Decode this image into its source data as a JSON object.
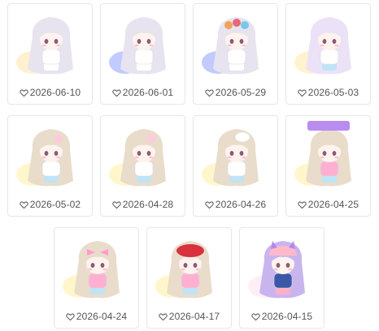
{
  "icons": {
    "like": "heart-outline-icon"
  },
  "colors": {
    "border": "#e6e6e6",
    "date_text": "#555555"
  },
  "items": [
    {
      "date": "2026-06-10",
      "hair": "#e7e4ef",
      "top": "#ffffff",
      "bottom": "#ffffff",
      "acc": "none",
      "aura": "#ffe6a6"
    },
    {
      "date": "2026-06-01",
      "hair": "#e7e4ef",
      "top": "#ffffff",
      "bottom": "#ffffff",
      "acc": "none",
      "aura": "#8fa0ff"
    },
    {
      "date": "2026-05-29",
      "hair": "#e7e4ef",
      "top": "#ffffff",
      "bottom": "#ffffff",
      "acc": "bears",
      "aura": "#8fa0ff"
    },
    {
      "date": "2026-05-03",
      "hair": "#ece2f7",
      "top": "#ffffff",
      "bottom": "#bfe4f5",
      "acc": "none",
      "aura": "#ffe9a8"
    },
    {
      "date": "2026-05-02",
      "hair": "#e9dccb",
      "top": "#ffffff",
      "bottom": "#bfe4f5",
      "acc": "flower",
      "aura": "#fff0a0"
    },
    {
      "date": "2026-04-28",
      "hair": "#e9dccb",
      "top": "#ffffff",
      "bottom": "#bfe4f5",
      "acc": "flower",
      "aura": "#fff0a0"
    },
    {
      "date": "2026-04-26",
      "hair": "#e9dccb",
      "top": "#ffffff",
      "bottom": "#bfe4f5",
      "acc": "chefhat",
      "aura": "#fff0a0"
    },
    {
      "date": "2026-04-25",
      "hair": "#e9dccb",
      "top": "#ffb0d0",
      "bottom": "#bfe4f5",
      "acc": "hope",
      "aura": "#fff0a0"
    },
    {
      "date": "2026-04-24",
      "hair": "#e9dccb",
      "top": "#ffb0d0",
      "bottom": "#bfe4f5",
      "acc": "ribbon",
      "aura": "#fff0a0"
    },
    {
      "date": "2026-04-17",
      "hair": "#e9dccb",
      "top": "#ffb0d0",
      "bottom": "#bfe4f5",
      "acc": "beret",
      "aura": "#fff0a0"
    },
    {
      "date": "2026-04-15",
      "hair": "#c9b5ee",
      "top": "#3a57a8",
      "bottom": "#ffb0c8",
      "acc": "cathat",
      "aura": "#ffe0f0"
    }
  ]
}
